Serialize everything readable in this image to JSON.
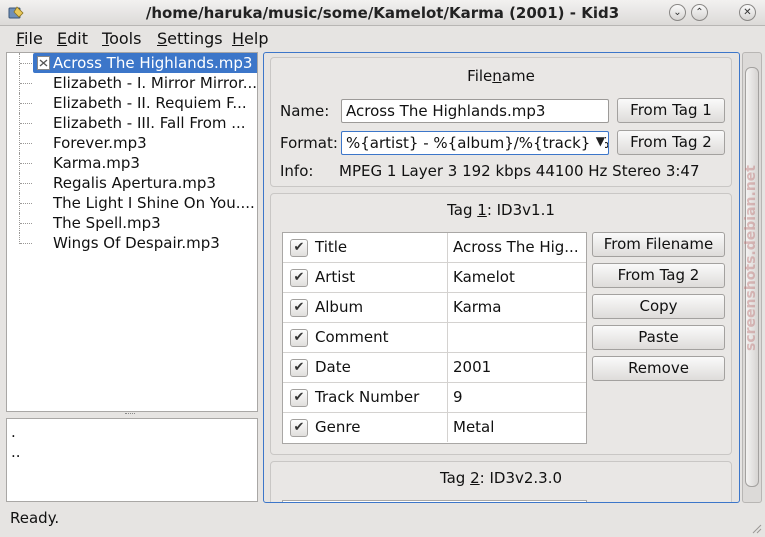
{
  "window": {
    "title": "/home/haruka/music/some/Kamelot/Karma (2001) - Kid3",
    "buttons": {
      "minimize": "⌄",
      "maximize": "⌃",
      "close": "✕"
    }
  },
  "menu": [
    {
      "label": "File",
      "mnemonic": "F",
      "rest": "ile"
    },
    {
      "label": "Edit",
      "mnemonic": "E",
      "rest": "dit"
    },
    {
      "label": "Tools",
      "mnemonic": "T",
      "rest": "ools"
    },
    {
      "label": "Settings",
      "mnemonic": "S",
      "rest": "ettings"
    },
    {
      "label": "Help",
      "mnemonic": "H",
      "rest": "elp"
    }
  ],
  "file_tree": {
    "selected_index": 0,
    "files": [
      "Across The Highlands.mp3",
      "Elizabeth - I. Mirror Mirror....",
      "Elizabeth - II. Requiem F...",
      "Elizabeth - III. Fall From ...",
      "Forever.mp3",
      "Karma.mp3",
      "Regalis Apertura.mp3",
      "The Light I Shine On You....",
      "The Spell.mp3",
      "Wings Of Despair.mp3"
    ]
  },
  "dir_list": [
    ".",
    ".."
  ],
  "filename_box": {
    "title_pre": "File",
    "title_mn": "n",
    "title_post": "ame",
    "name_label": "Name:",
    "name_value": "Across The Highlands.mp3",
    "format_label": "Format:",
    "format_value": "%{artist} - %{album}/%{track} %{title}",
    "info_label": "Info:",
    "info_value": "MPEG 1 Layer 3 192 kbps 44100 Hz Stereo 3:47",
    "from_tag1": "From Tag 1",
    "from_tag2": "From Tag 2"
  },
  "tag1": {
    "title_pre": "Tag ",
    "title_mn": "1",
    "title_post": ": ID3v1.1",
    "fields": [
      {
        "name": "Title",
        "value": "Across The Hig...",
        "checked": true
      },
      {
        "name": "Artist",
        "value": "Kamelot",
        "checked": true
      },
      {
        "name": "Album",
        "value": "Karma",
        "checked": true
      },
      {
        "name": "Comment",
        "value": "",
        "checked": true
      },
      {
        "name": "Date",
        "value": "2001",
        "checked": true
      },
      {
        "name": "Track Number",
        "value": "9",
        "checked": true
      },
      {
        "name": "Genre",
        "value": "Metal",
        "checked": true
      }
    ],
    "buttons": {
      "from_filename": "From Filename",
      "from_tag2": "From Tag 2",
      "copy": "Copy",
      "paste": "Paste",
      "remove": "Remove"
    }
  },
  "tag2": {
    "title_pre": "Tag ",
    "title_mn": "2",
    "title_post": ": ID3v2.3.0"
  },
  "watermark": "screenshots.debian.net",
  "status": "Ready.",
  "colors": {
    "selection": "#3c76c9",
    "window_bg": "#e6e4e2"
  }
}
